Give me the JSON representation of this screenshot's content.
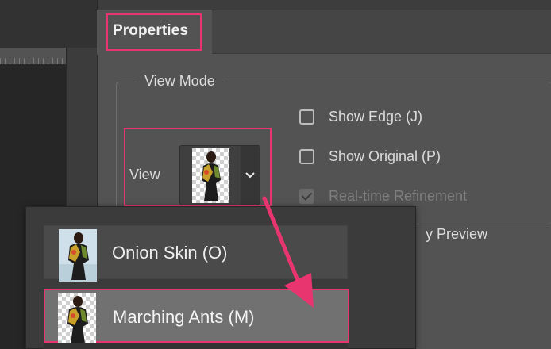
{
  "panel": {
    "tab_title": "Properties"
  },
  "view_mode": {
    "legend": "View Mode",
    "view_label": "View",
    "selected_thumbnail_icon": "marching-ants-thumbnail-icon",
    "chevron_icon": "chevron-down-icon"
  },
  "options": [
    {
      "label": "Show Edge (J)",
      "checked": false,
      "disabled": false
    },
    {
      "label": "Show Original (P)",
      "checked": false,
      "disabled": false
    },
    {
      "label": "Real-time Refinement",
      "checked": true,
      "disabled": true
    }
  ],
  "partial_option_text": "y Preview",
  "dropdown": {
    "items": [
      {
        "label": "Onion Skin (O)",
        "icon": "onion-skin-thumbnail-icon",
        "selected": false
      },
      {
        "label": "Marching Ants (M)",
        "icon": "marching-ants-thumbnail-icon",
        "selected": true
      }
    ]
  },
  "colors": {
    "highlight": "#e8356f",
    "panel_bg": "#535353",
    "dropdown_bg": "#3b3b3b",
    "selected_item_bg": "#717171"
  }
}
